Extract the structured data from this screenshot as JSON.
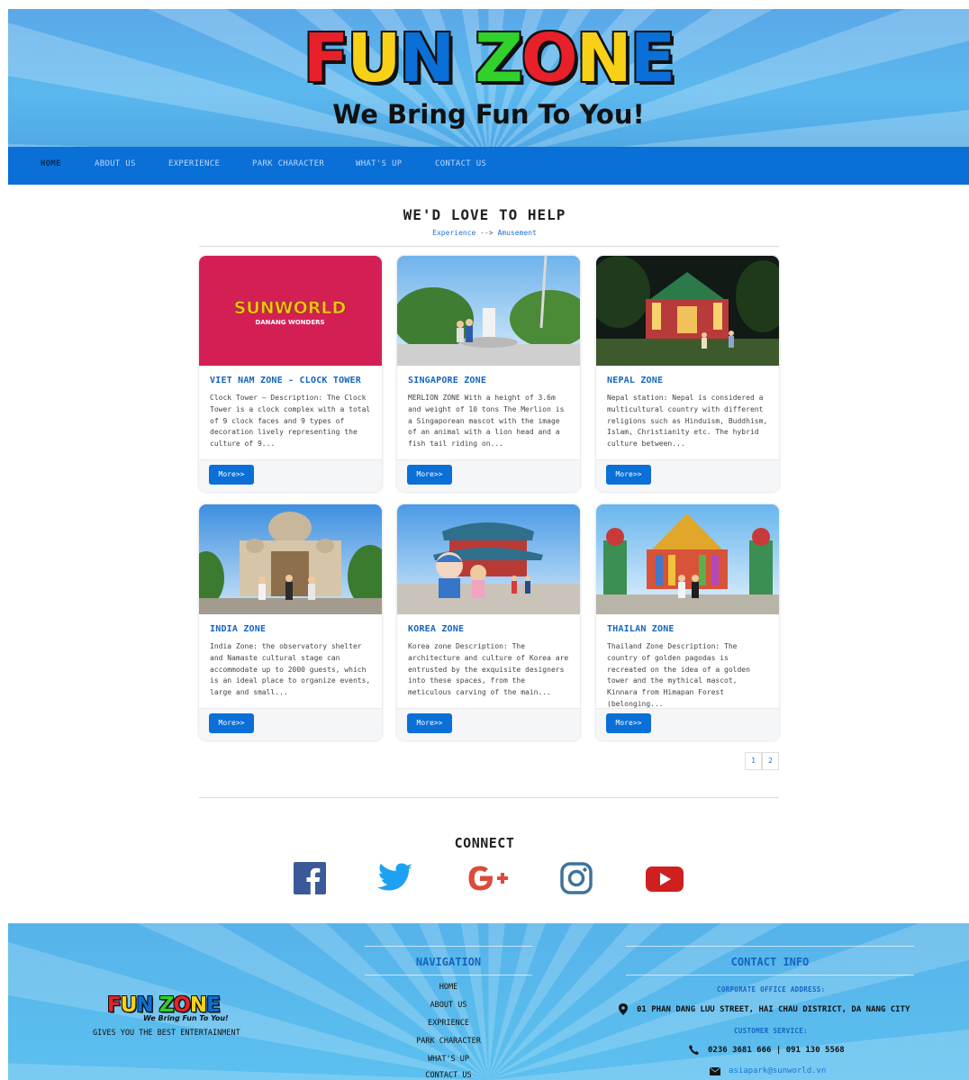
{
  "brand": {
    "logo_word1": "FUN",
    "logo_word2": "ZONE",
    "tagline": "We Bring Fun To You!",
    "colors": {
      "blue": "#0a6fd6",
      "red": "#e8202a",
      "yellow": "#f7d117",
      "green": "#2fd12a"
    }
  },
  "nav": {
    "items": [
      {
        "label": "HOME",
        "active": true
      },
      {
        "label": "ABOUT US"
      },
      {
        "label": "EXPERIENCE"
      },
      {
        "label": "PARK CHARACTER"
      },
      {
        "label": "WHAT'S UP"
      },
      {
        "label": "CONTACT US"
      }
    ]
  },
  "main": {
    "title": "WE'D LOVE TO HELP",
    "breadcrumb": {
      "first": "Experience",
      "separator": "-->",
      "second": "Amusement"
    },
    "more_label": "More>>",
    "sunworld_logo": "SUNWORLD",
    "sunworld_sub": "DANANG WONDERS",
    "cards": [
      {
        "title": "VIET NAM ZONE - CLOCK TOWER",
        "desc": "Clock Tower – Description: The Clock Tower is a clock complex with a total of 9 clock faces and 9 types of decoration lively representing the culture of 9..."
      },
      {
        "title": "SINGAPORE ZONE",
        "desc": "MERLION ZONE With a height of 3.6m and weight of 10 tons The Merlion is a Singaporean mascot with the image of an animal with a lion head and a fish tail riding on..."
      },
      {
        "title": "NEPAL ZONE",
        "desc": "Nepal station: Nepal is considered a multicultural country with different religions such as Hinduism, Buddhism, Islam, Christianity etc. The hybrid culture between..."
      },
      {
        "title": "INDIA ZONE",
        "desc": "India Zone: the observatory shelter and Namaste cultural stage can accommodate up to 2000 guests, which is an ideal place to organize events, large and small..."
      },
      {
        "title": "KOREA ZONE",
        "desc": "Korea zone Description: The architecture and culture of Korea are entrusted by the exquisite designers into these spaces, from the meticulous carving of the main..."
      },
      {
        "title": "THAILAN ZONE",
        "desc": "Thailand Zone Description: The country of golden pagodas is recreated on the idea of a golden tower and the mythical mascot, Kinnara from Himapan Forest (belonging..."
      }
    ],
    "pages": [
      "1",
      "2"
    ]
  },
  "connect": {
    "title": "CONNECT",
    "icons": [
      "facebook-icon",
      "twitter-icon",
      "google-plus-icon",
      "instagram-icon",
      "youtube-icon"
    ]
  },
  "footer": {
    "slogan": "GIVES YOU THE BEST ENTERTAINMENT",
    "nav_title": "NAVIGATION",
    "nav_items": [
      "HOME",
      "ABOUT US",
      "EXPRIENCE",
      "PARK CHARACTER",
      "WHAT'S UP",
      "CONTACT US"
    ],
    "contact_title": "CONTACT INFO",
    "office_label": "CORPORATE OFFICE ADDRESS:",
    "address": "01 PHAN DANG LUU STREET, HAI CHAU DISTRICT, DA NANG CITY",
    "service_label": "CUSTOMER SERVICE:",
    "phone": "0236 3681 666 | 091 130 5568",
    "email": "asiapark@sunworld.vn"
  }
}
